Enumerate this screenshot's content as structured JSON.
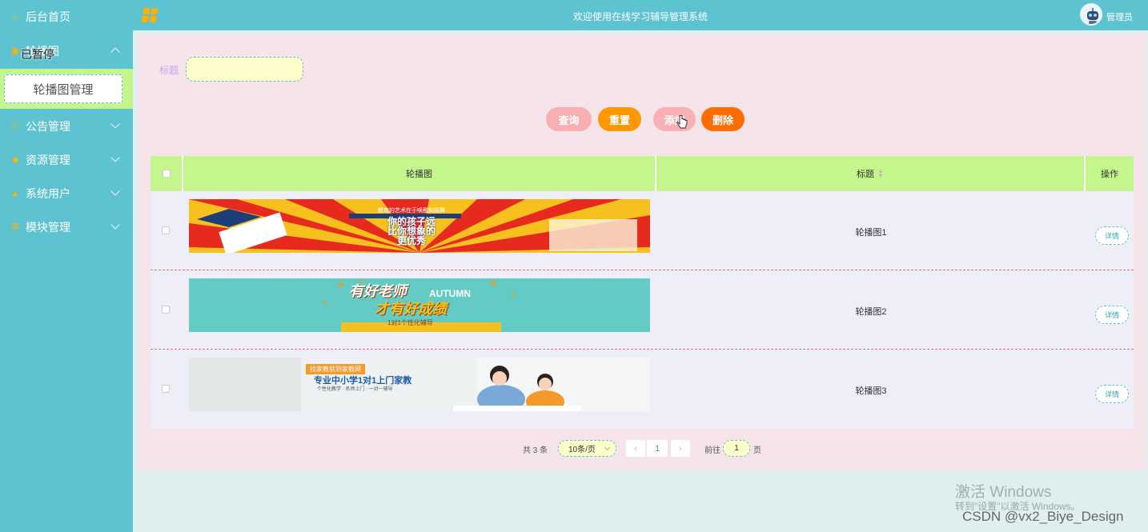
{
  "sidebar": {
    "items": [
      {
        "label": "后台首页",
        "icon": "home-icon"
      },
      {
        "label": "轮播图",
        "icon": "image-icon"
      },
      {
        "label": "公告管理",
        "icon": "notice-icon"
      },
      {
        "label": "资源管理",
        "icon": "resource-icon"
      },
      {
        "label": "系统用户",
        "icon": "user-icon"
      },
      {
        "label": "模块管理",
        "icon": "module-icon"
      }
    ],
    "overlay_text": "已暂停",
    "sub_item": "轮播图管理"
  },
  "header": {
    "title": "欢迎使用在线学习辅导管理系统",
    "user": "管理员"
  },
  "search": {
    "label": "标题",
    "placeholder": "",
    "value": ""
  },
  "buttons": {
    "query": "查询",
    "reset": "重置",
    "add": "添加",
    "delete": "删除"
  },
  "table": {
    "columns": [
      "轮播图",
      "标题",
      "操作"
    ],
    "rows": [
      {
        "title": "轮播图1",
        "action": "详情",
        "banner": {
          "lines": [
            "你的孩子远",
            "比你想象的",
            "更优秀"
          ],
          "tag": "教育的艺术在于唤醒和鼓舞"
        }
      },
      {
        "title": "轮播图2",
        "action": "详情",
        "banner": {
          "lines": [
            "有好老师",
            "才有好成绩"
          ],
          "tag": "AUTUMN",
          "sub": "1对1个性化辅导"
        }
      },
      {
        "title": "轮播图3",
        "action": "详情",
        "banner": {
          "lines": [
            "专业中小学1对1上门家教"
          ],
          "tag": "找家教就到家教网",
          "sub": "个性化教学 · 名师上门 · 一对一辅导"
        }
      }
    ]
  },
  "pagination": {
    "total": "共 3 条",
    "page_size": "10条/页",
    "current": "1",
    "goto_label": "前往",
    "goto_value": "1",
    "page_suffix": "页"
  },
  "watermark": {
    "line1": "激活 Windows",
    "line2": "转到\"设置\"以激活 Windows。",
    "csdn": "CSDN @vx2_Biye_Design"
  },
  "colors": {
    "sidebar": "#5ec3d0",
    "accent_green": "#c5f58d",
    "panel": "#f5e4ea",
    "orange": "#ff9800",
    "pink": "#f9aeb2"
  }
}
